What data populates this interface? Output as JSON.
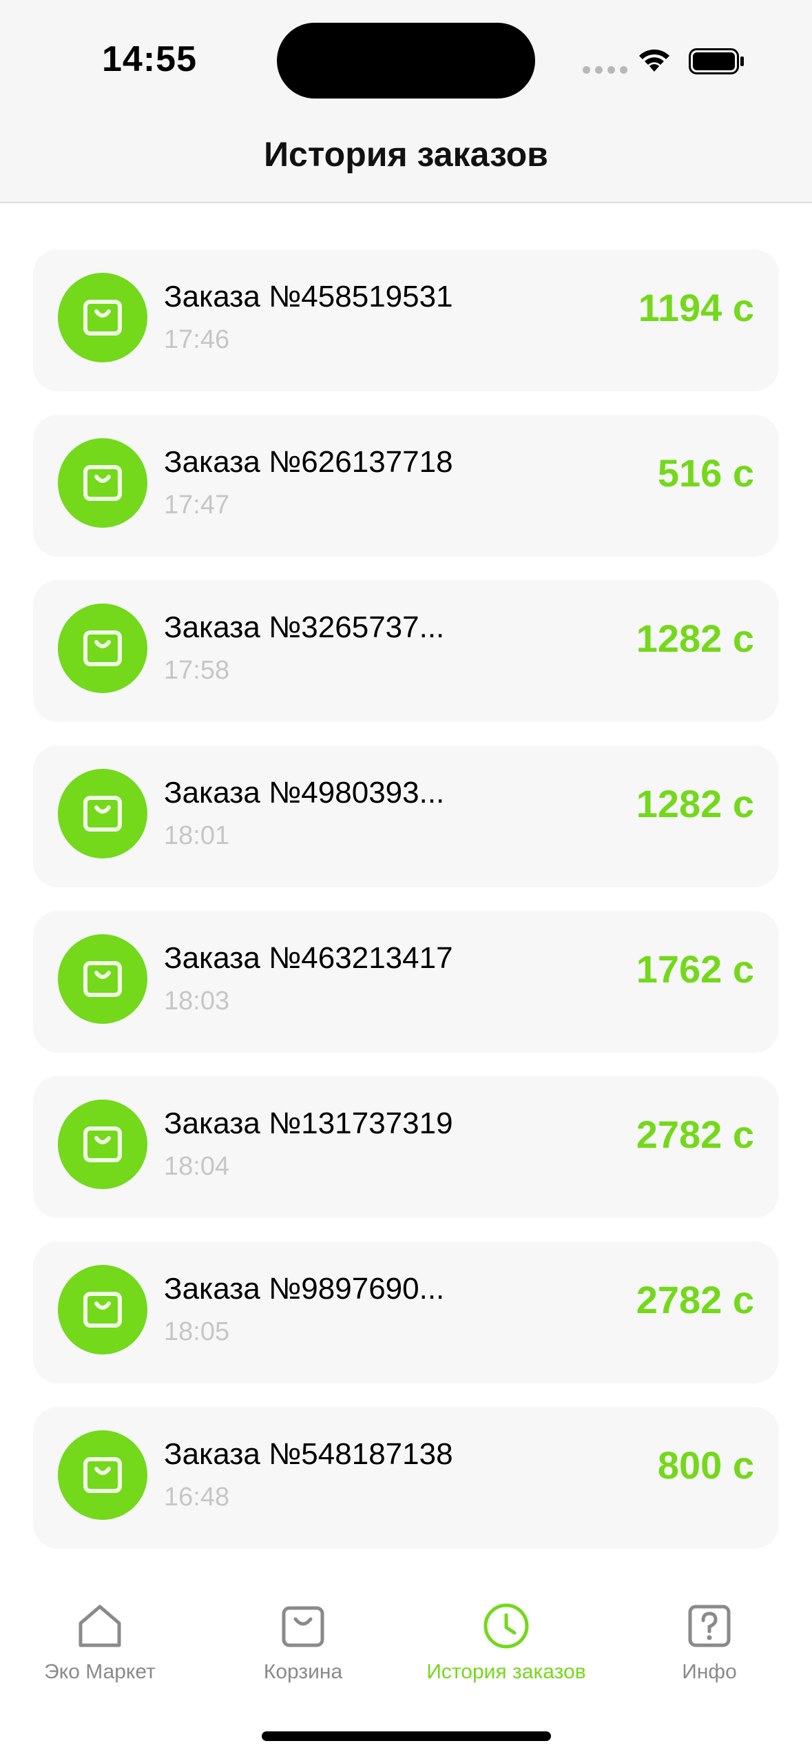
{
  "status": {
    "time": "14:55"
  },
  "header": {
    "title": "История заказов"
  },
  "orders": [
    {
      "title": "Заказа №458519531",
      "time": "17:46",
      "price": "1194 с"
    },
    {
      "title": "Заказа №626137718",
      "time": "17:47",
      "price": "516 с"
    },
    {
      "title": "Заказа №3265737...",
      "time": "17:58",
      "price": "1282 с"
    },
    {
      "title": "Заказа №4980393...",
      "time": "18:01",
      "price": "1282 с"
    },
    {
      "title": "Заказа №463213417",
      "time": "18:03",
      "price": "1762 с"
    },
    {
      "title": "Заказа №131737319",
      "time": "18:04",
      "price": "2782 с"
    },
    {
      "title": "Заказа №9897690...",
      "time": "18:05",
      "price": "2782 с"
    },
    {
      "title": "Заказа №548187138",
      "time": "16:48",
      "price": "800 с"
    }
  ],
  "tabs": [
    {
      "label": "Эко Маркет",
      "icon": "home-icon"
    },
    {
      "label": "Корзина",
      "icon": "bag-icon"
    },
    {
      "label": "История заказов",
      "icon": "clock-icon",
      "active": true
    },
    {
      "label": "Инфо",
      "icon": "question-icon"
    }
  ],
  "colors": {
    "accent": "#74d81b",
    "inactive": "#8a8a8a",
    "card": "#f7f7f7"
  }
}
